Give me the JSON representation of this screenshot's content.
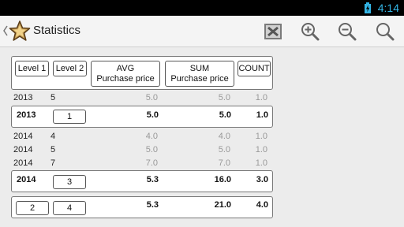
{
  "status": {
    "time": "4:14"
  },
  "actionbar": {
    "title": "Statistics",
    "icons": [
      "excel-export-icon",
      "zoom-in-icon",
      "zoom-out-icon",
      "search-icon"
    ]
  },
  "headers": {
    "level1": "Level 1",
    "level2": "Level 2",
    "avg_line1": "AVG",
    "avg_line2": "Purchase price",
    "sum_line1": "SUM",
    "sum_line2": "Purchase price",
    "count": "COUNT"
  },
  "rows": [
    {
      "level1": "2013",
      "level2": "5",
      "avg": "5.0",
      "sum": "5.0",
      "count": "1.0"
    },
    {
      "level1": "2013",
      "level2": "1",
      "avg": "5.0",
      "sum": "5.0",
      "count": "1.0",
      "subtotal": true
    },
    {
      "level1": "2014",
      "level2": "4",
      "avg": "4.0",
      "sum": "4.0",
      "count": "1.0"
    },
    {
      "level1": "2014",
      "level2": "5",
      "avg": "5.0",
      "sum": "5.0",
      "count": "1.0"
    },
    {
      "level1": "2014",
      "level2": "7",
      "avg": "7.0",
      "sum": "7.0",
      "count": "1.0"
    },
    {
      "level1": "2014",
      "level2": "3",
      "avg": "5.3",
      "sum": "16.0",
      "count": "3.0",
      "subtotal": true
    },
    {
      "level1": "2",
      "level2": "4",
      "avg": "5.3",
      "sum": "21.0",
      "count": "4.0",
      "total": true
    }
  ]
}
